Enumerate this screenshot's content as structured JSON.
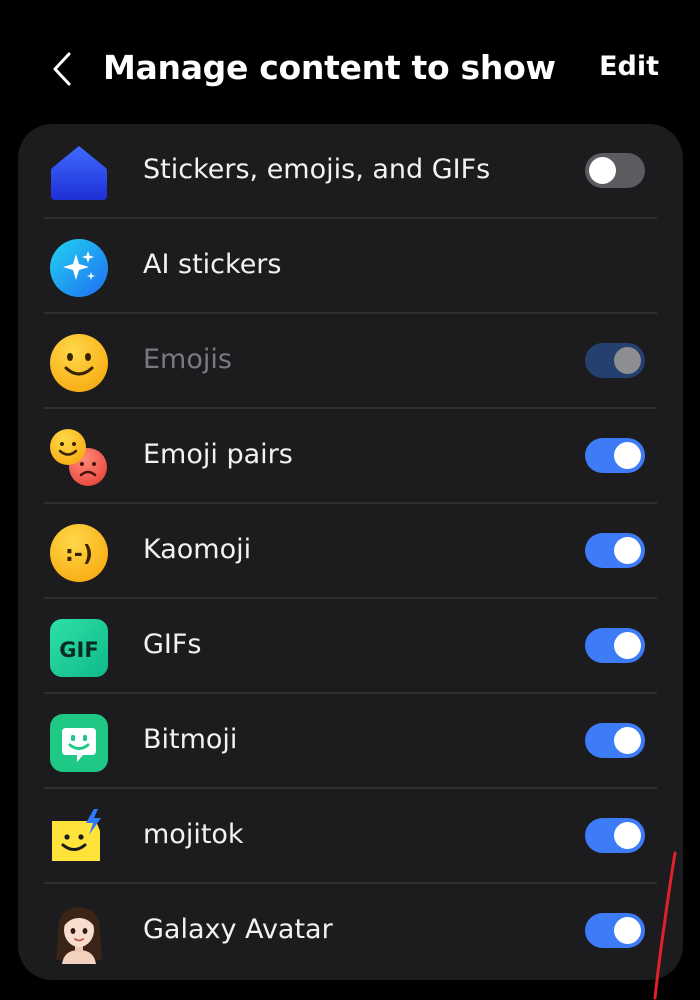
{
  "header": {
    "title": "Manage content to show",
    "edit_label": "Edit"
  },
  "items": [
    {
      "label": "Stickers, emojis, and GIFs",
      "icon": "home-icon",
      "toggle": "off",
      "dim": false
    },
    {
      "label": "AI stickers",
      "icon": "sparkle-icon",
      "toggle": null,
      "dim": false
    },
    {
      "label": "Emojis",
      "icon": "smiley-icon",
      "toggle": "on-disabled",
      "dim": true
    },
    {
      "label": "Emoji pairs",
      "icon": "emoji-pair-icon",
      "toggle": "on",
      "dim": false
    },
    {
      "label": "Kaomoji",
      "icon": "kaomoji-icon",
      "kaomoji_text": ":-)",
      "toggle": "on",
      "dim": false
    },
    {
      "label": "GIFs",
      "icon": "gif-icon",
      "icon_text": "GIF",
      "toggle": "on",
      "dim": false
    },
    {
      "label": "Bitmoji",
      "icon": "bitmoji-icon",
      "toggle": "on",
      "dim": false
    },
    {
      "label": "mojitok",
      "icon": "mojitok-icon",
      "toggle": "on",
      "dim": false
    },
    {
      "label": "Galaxy Avatar",
      "icon": "avatar-icon",
      "toggle": "on",
      "dim": false
    }
  ],
  "colors": {
    "background": "#000000",
    "card": "#1c1c1e",
    "toggle_on": "#3e7bf6",
    "toggle_off": "#5c5c60",
    "toggle_disabled": "#24406f",
    "annotation": "#e0202a"
  }
}
